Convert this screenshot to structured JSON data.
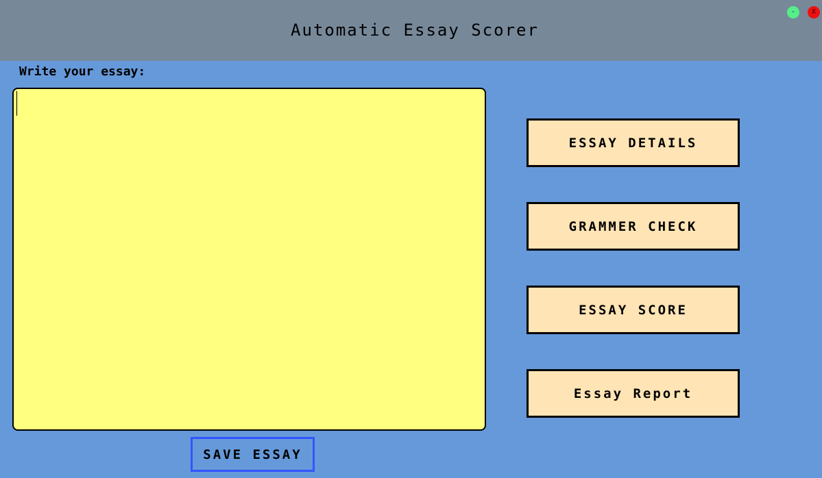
{
  "window": {
    "title": "Automatic Essay Scorer",
    "minimize_label": "-",
    "close_label": "X"
  },
  "essay": {
    "label": "Write your essay:",
    "value": ""
  },
  "buttons": {
    "essay_details": "ESSAY DETAILS",
    "grammer_check": "GRAMMER CHECK",
    "essay_score": "ESSAY SCORE",
    "essay_report": "Essay Report",
    "save_essay": "SAVE ESSAY"
  },
  "colors": {
    "background": "#6699d9",
    "titlebar": "#778899",
    "essay_box": "#ffff80",
    "button_fill": "#ffe4b5",
    "save_border": "#3355ff",
    "minimize": "#55ee88",
    "close": "#ee1111"
  }
}
